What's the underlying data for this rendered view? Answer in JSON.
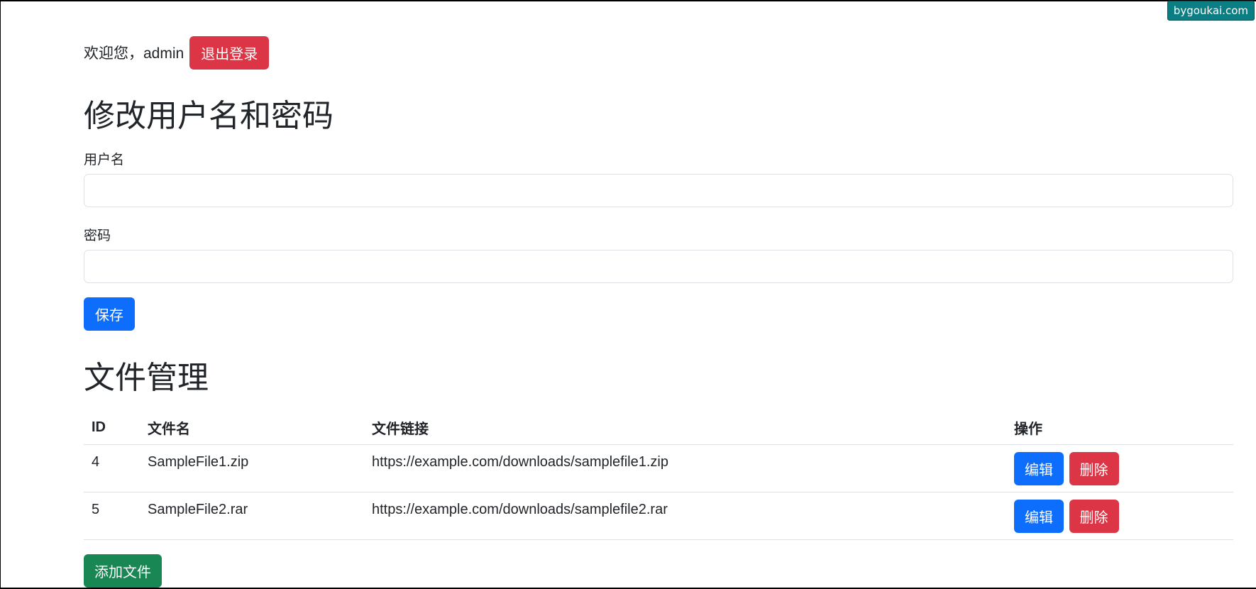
{
  "watermark": "bygoukai.com",
  "header": {
    "welcome_text": "欢迎您，admin",
    "logout_label": "退出登录"
  },
  "account": {
    "title": "修改用户名和密码",
    "username_label": "用户名",
    "username_value": "",
    "password_label": "密码",
    "password_value": "",
    "save_label": "保存"
  },
  "files": {
    "title": "文件管理",
    "columns": [
      "ID",
      "文件名",
      "文件链接",
      "操作"
    ],
    "rows": [
      {
        "id": "4",
        "name": "SampleFile1.zip",
        "link": "https://example.com/downloads/samplefile1.zip",
        "edit_label": "编辑",
        "delete_label": "删除"
      },
      {
        "id": "5",
        "name": "SampleFile2.rar",
        "link": "https://example.com/downloads/samplefile2.rar",
        "edit_label": "编辑",
        "delete_label": "删除"
      }
    ],
    "add_label": "添加文件"
  },
  "colors": {
    "danger": "#dc3545",
    "primary": "#0d6efd",
    "success": "#198754",
    "watermark_bg": "#0b7e84"
  }
}
